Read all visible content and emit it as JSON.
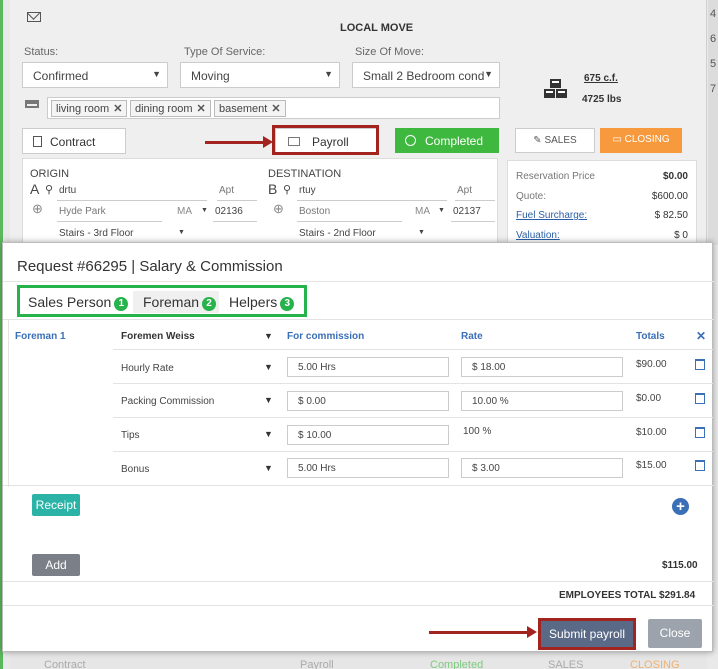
{
  "background": {
    "title": "LOCAL MOVE",
    "strip_numbers": [
      "4",
      "6",
      "5",
      "7"
    ],
    "status_label": "Status:",
    "status_value": "Confirmed",
    "service_label": "Type Of Service:",
    "service_value": "Moving",
    "size_label": "Size Of Move:",
    "size_value": "Small 2 Bedroom cond",
    "cubic_feet": "675 c.f.",
    "weight": "4725 lbs",
    "rooms": [
      "living room",
      "dining room",
      "basement"
    ],
    "contract_label": "Contract",
    "payroll_label": "Payroll",
    "completed_label": "Completed",
    "sales_label": "SALES",
    "closing_label": "CLOSING",
    "origin": {
      "title": "ORIGIN",
      "letter": "A",
      "address": "drtu",
      "apt_label": "Apt",
      "city": "Hyde Park",
      "state": "MA",
      "zip": "02136",
      "floor": "Stairs - 3rd Floor"
    },
    "destination": {
      "title": "DESTINATION",
      "letter": "B",
      "address": "rtuy",
      "apt_label": "Apt",
      "city": "Boston",
      "state": "MA",
      "zip": "02137",
      "floor": "Stairs - 2nd Floor"
    },
    "prices": [
      {
        "label": "Reservation Price",
        "value": "$0.00"
      },
      {
        "label": "Quote:",
        "value": "$600.00"
      },
      {
        "label": "Fuel Surcharge:",
        "value": "$ 82.50"
      },
      {
        "label": "Valuation:",
        "value": "$ 0"
      }
    ],
    "ghost": {
      "contract": "Contract",
      "payroll": "Payroll",
      "completed": "Completed",
      "sales": "SALES",
      "closing": "CLOSING"
    }
  },
  "modal": {
    "title": "Request #66295 | Salary & Commission",
    "tabs": [
      {
        "label": "Sales Person",
        "badge": "1"
      },
      {
        "label": "Foreman",
        "badge": "2"
      },
      {
        "label": "Helpers",
        "badge": "3"
      }
    ],
    "foreman_label": "Foreman 1",
    "foreman_name": "Foremen Weiss",
    "headers": {
      "commission": "For commission",
      "rate": "Rate",
      "totals": "Totals"
    },
    "rows": [
      {
        "type": "Hourly Rate",
        "commission": "5.00 Hrs",
        "rate": "$ 18.00",
        "total": "$90.00"
      },
      {
        "type": "Packing Commission",
        "commission": "$ 0.00",
        "rate": "10.00 %",
        "total": "$0.00"
      },
      {
        "type": "Tips",
        "commission": "$ 10.00",
        "rate": "100 %",
        "total": "$10.00"
      },
      {
        "type": "Bonus",
        "commission": "5.00 Hrs",
        "rate": "$ 3.00",
        "total": "$15.00"
      }
    ],
    "receipt_label": "Receipt",
    "add_label": "Add",
    "subtotal": "$115.00",
    "employees_total": "EMPLOYEES TOTAL $291.84",
    "submit_label": "Submit payroll",
    "close_label": "Close"
  },
  "colors": {
    "accent_green": "#27b34b",
    "highlight_red": "#a3231f",
    "link_blue": "#3b6fb6"
  }
}
